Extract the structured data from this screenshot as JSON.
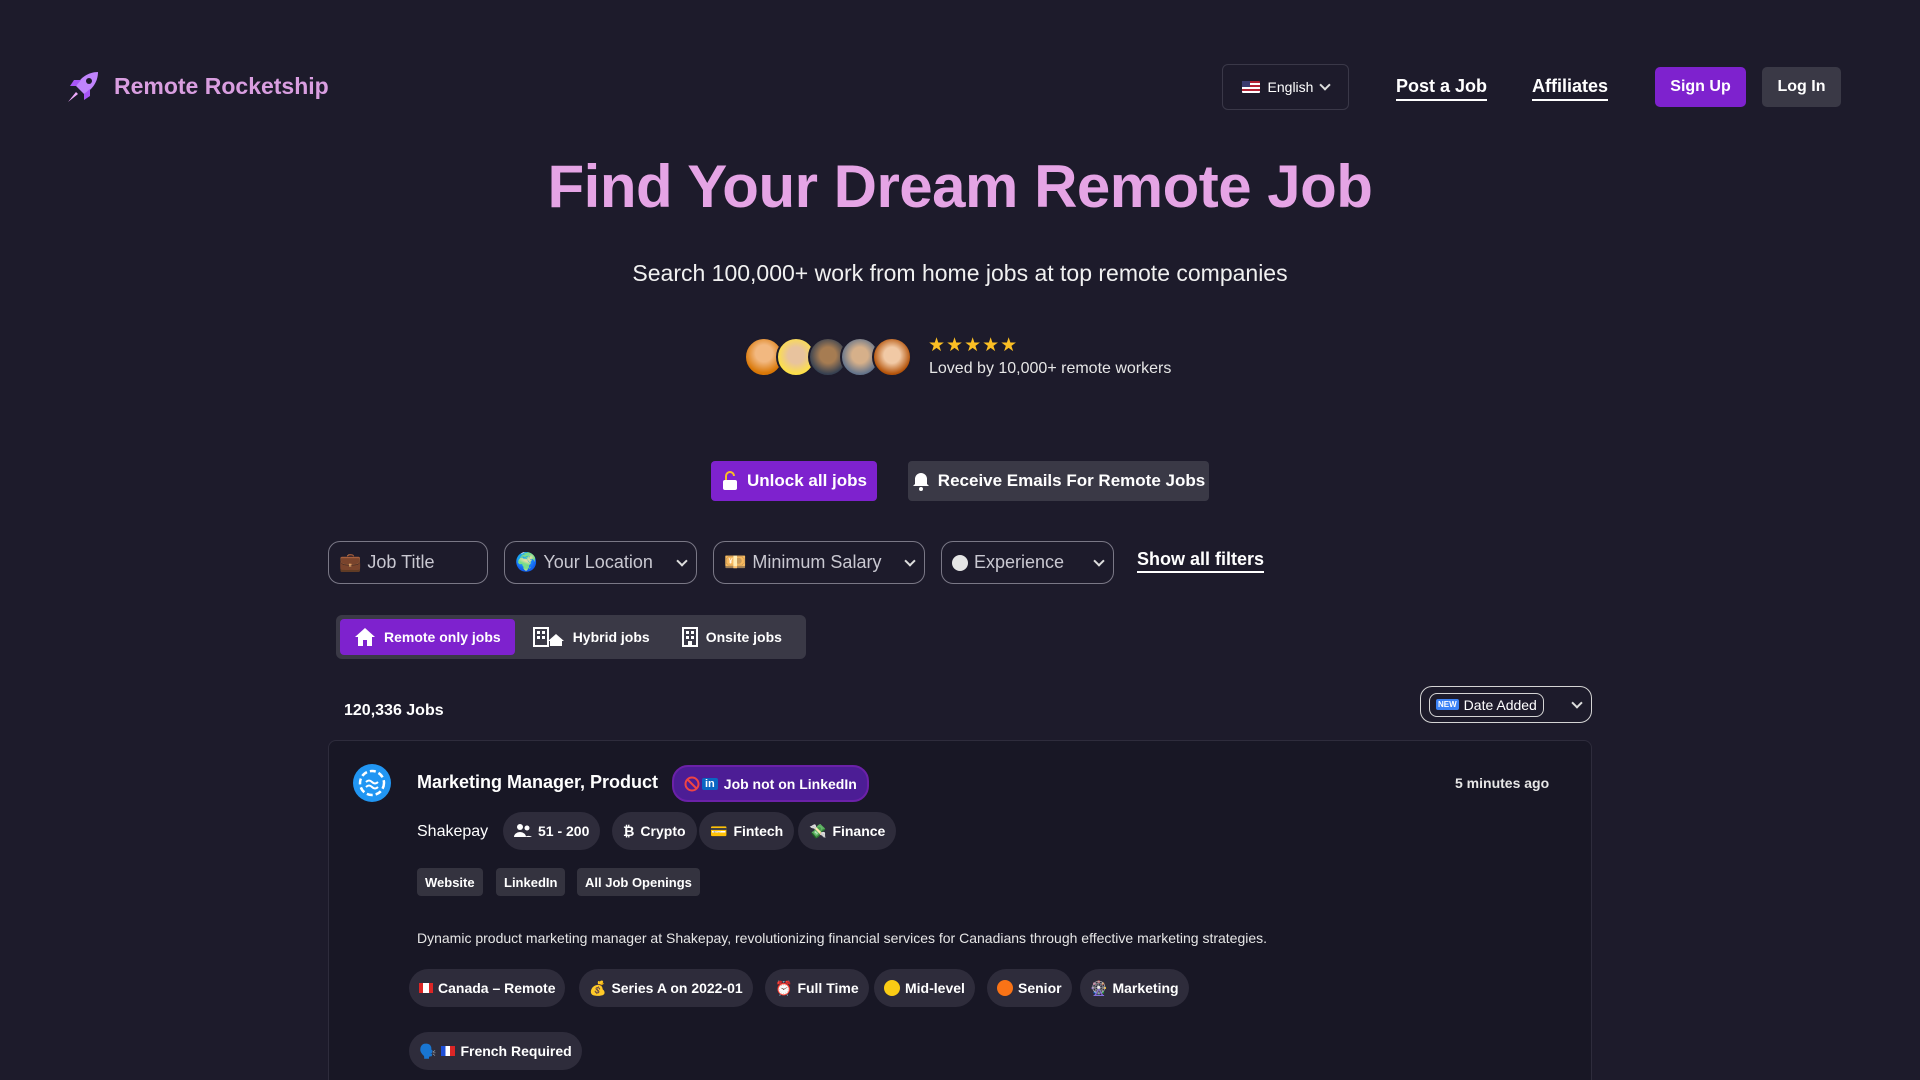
{
  "header": {
    "brand": "Remote Rocketship",
    "language": "English",
    "post_job": "Post a Job",
    "affiliates": "Affiliates",
    "sign_up": "Sign Up",
    "log_in": "Log In"
  },
  "hero": {
    "title": "Find Your Dream Remote Job",
    "subtitle": "Search 100,000+ work from home jobs at top remote companies",
    "stars": "★★★★★",
    "loved": "Loved by 10,000+ remote workers",
    "unlock": "Unlock all jobs",
    "emails": "Receive Emails For Remote Jobs"
  },
  "filters": {
    "job_title": "Job Title",
    "location": "Your Location",
    "salary": "Minimum Salary",
    "experience": "Experience",
    "show_all": "Show all filters"
  },
  "work_type": {
    "remote": "Remote only jobs",
    "hybrid": "Hybrid jobs",
    "onsite": "Onsite jobs"
  },
  "results": {
    "count": "120,336 Jobs",
    "sort_label": "Date Added",
    "sort_badge": "NEW"
  },
  "job": {
    "title": "Marketing Manager, Product",
    "linkedin_badge": "Job not on LinkedIn",
    "posted": "5 minutes ago",
    "company": "Shakepay",
    "company_size": "51 - 200",
    "industry_1": "Crypto",
    "industry_1_glyph": "₿",
    "industry_2": "Fintech",
    "industry_3": "Finance",
    "links": [
      "Website",
      "LinkedIn",
      "All Job Openings"
    ],
    "description": "Dynamic product marketing manager at Shakepay, revolutionizing financial services for Canadians through effective marketing strategies.",
    "tags": {
      "location": "Canada – Remote",
      "funding": "Series A on 2022-01",
      "type": "Full Time",
      "level_1": "Mid-level",
      "level_2": "Senior",
      "department": "Marketing",
      "language": "French Required"
    }
  },
  "colors": {
    "background": "#1d1b2b",
    "brand_pink": "#e5a4e5",
    "primary_purple": "#7e22ce",
    "secondary_gray": "#3a3946",
    "star_yellow": "#fbbf24"
  }
}
